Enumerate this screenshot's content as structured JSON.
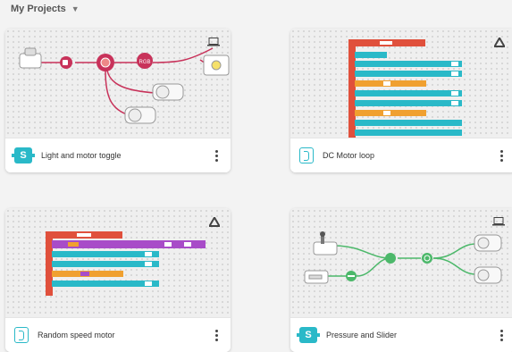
{
  "header": {
    "title": "My Projects",
    "dropdown_icon": "chevron-down-icon"
  },
  "projects": [
    {
      "name": "Light and motor toggle",
      "type_badge": "S",
      "corner_icon": "laptop-icon",
      "node_label": "RGB"
    },
    {
      "name": "DC Motor loop",
      "type_badge": "blocks",
      "corner_icon": "drive-icon"
    },
    {
      "name": "Random speed motor",
      "type_badge": "blocks",
      "corner_icon": "drive-icon"
    },
    {
      "name": "Pressure and Slider",
      "type_badge": "S",
      "corner_icon": "laptop-icon"
    }
  ],
  "colors": {
    "accent": "#2ab9c8",
    "flow_red": "#c8325a",
    "flow_green": "#4cb86a",
    "block_red": "#e0503c",
    "block_teal": "#2ab9c8",
    "block_purple": "#a84cc8",
    "block_orange": "#f0a030"
  }
}
